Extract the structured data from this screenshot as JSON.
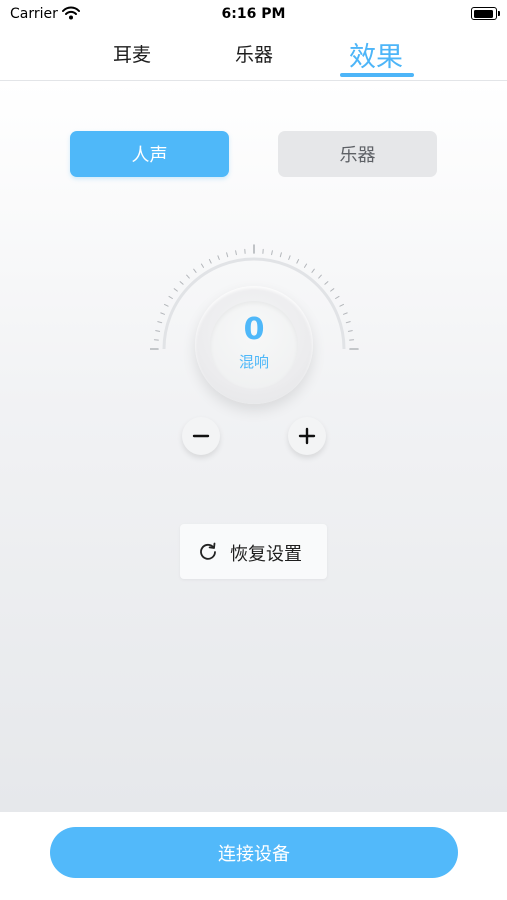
{
  "status_bar": {
    "carrier": "Carrier",
    "time": "6:16 PM"
  },
  "tabs": [
    {
      "label": "耳麦"
    },
    {
      "label": "乐器"
    },
    {
      "label": "效果",
      "active": true
    }
  ],
  "segments": {
    "vocal": "人声",
    "instrument": "乐器",
    "active": "vocal"
  },
  "knob": {
    "value": "0",
    "label": "混响"
  },
  "steppers": {
    "minus_icon": "minus-icon",
    "plus_icon": "plus-icon"
  },
  "reset": {
    "label": "恢复设置",
    "icon": "refresh-icon"
  },
  "connect": {
    "label": "连接设备"
  },
  "colors": {
    "accent": "#4fb8f9",
    "text": "#1e1e1e",
    "inactive_segment": "#e6e7e9"
  }
}
